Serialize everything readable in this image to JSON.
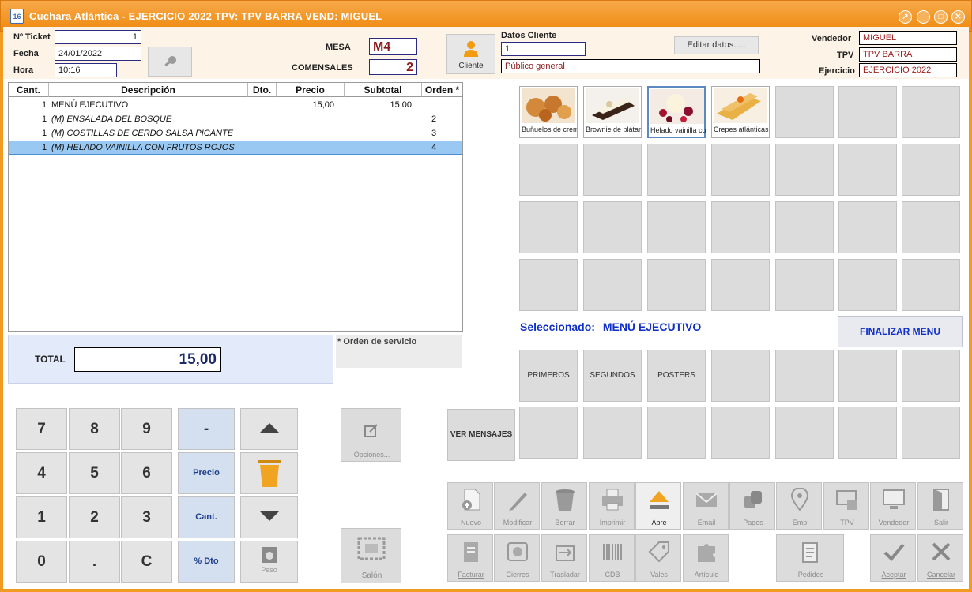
{
  "window": {
    "title": "Cuchara Atlántica - EJERCICIO 2022 TPV: TPV BARRA VEND: MIGUEL",
    "icon_text": "16"
  },
  "header": {
    "ticket_label": "Nº Ticket",
    "ticket_value": "1",
    "fecha_label": "Fecha",
    "fecha_value": "24/01/2022",
    "hora_label": "Hora",
    "hora_value": "10:16",
    "mesa_label": "MESA",
    "mesa_value": "M4",
    "comensales_label": "COMENSALES",
    "comensales_value": "2",
    "cliente_button": "Cliente",
    "datos_cliente_label": "Datos Cliente",
    "cliente_code": "1",
    "cliente_name": "Público general",
    "editar_button": "Editar datos.....",
    "vendedor_label": "Vendedor",
    "vendedor_value": "MIGUEL",
    "tpv_label": "TPV",
    "tpv_value": "TPV BARRA",
    "ejercicio_label": "Ejercicio",
    "ejercicio_value": "EJERCICIO 2022"
  },
  "table": {
    "headers": [
      "Cant.",
      "Descripción",
      "Dto.",
      "Precio",
      "Subtotal",
      "Orden *"
    ],
    "rows": [
      {
        "cant": "1",
        "desc": "MENÚ EJECUTIVO",
        "precio": "15,00",
        "subtotal": "15,00",
        "orden": ""
      },
      {
        "cant": "1",
        "desc": "(M) ENSALADA DEL BOSQUE",
        "precio": "",
        "subtotal": "",
        "orden": "2"
      },
      {
        "cant": "1",
        "desc": "(M) COSTILLAS DE CERDO SALSA PICANTE",
        "precio": "",
        "subtotal": "",
        "orden": "3"
      },
      {
        "cant": "1",
        "desc": "(M) HELADO VAINILLA CON FRUTOS ROJOS",
        "precio": "",
        "subtotal": "",
        "orden": "4"
      }
    ]
  },
  "total": {
    "label": "TOTAL",
    "value": "15,00"
  },
  "orden_servicio": "* Orden de servicio",
  "keypad": {
    "keys": [
      "7",
      "8",
      "9",
      "-",
      "4",
      "5",
      "6",
      "Precio",
      "1",
      "2",
      "3",
      "Cant.",
      "0",
      ".",
      "C",
      "% Dto"
    ],
    "peso": "Peso",
    "opciones": "Opciones...",
    "salon": "Salón"
  },
  "products": [
    {
      "label": "Buñuelos de crema",
      "icon": "bunuelos-image"
    },
    {
      "label": "Brownie de plátano",
      "icon": "brownie-image"
    },
    {
      "label": "Helado vainilla con frutos rojos",
      "icon": "helado-image"
    },
    {
      "label": "Crepes atlánticas",
      "icon": "crepes-image"
    }
  ],
  "seleccionado": {
    "label": "Seleccionado:",
    "value": "MENÚ EJECUTIVO"
  },
  "finalizar_menu": "FINALIZAR MENU",
  "categories": [
    "PRIMEROS",
    "SEGUNDOS",
    "POSTERS"
  ],
  "ver_mensajes": "VER MENSAJES",
  "toolbar1": [
    "Nuevo",
    "Modificar",
    "Borrar",
    "Imprimir",
    "Abre",
    "Email",
    "Pagos",
    "Emp",
    "TPV",
    "Vendedor",
    "Salir"
  ],
  "toolbar2": [
    "Facturar",
    "Cierres",
    "Trasladar",
    "CDB",
    "Vales",
    "Artículo",
    "Pedidos",
    "Aceptar",
    "Cancelar"
  ],
  "colors": {
    "accent": "#f19b22",
    "link_blue": "#1030c8",
    "selected_row": "#99c9f3"
  }
}
